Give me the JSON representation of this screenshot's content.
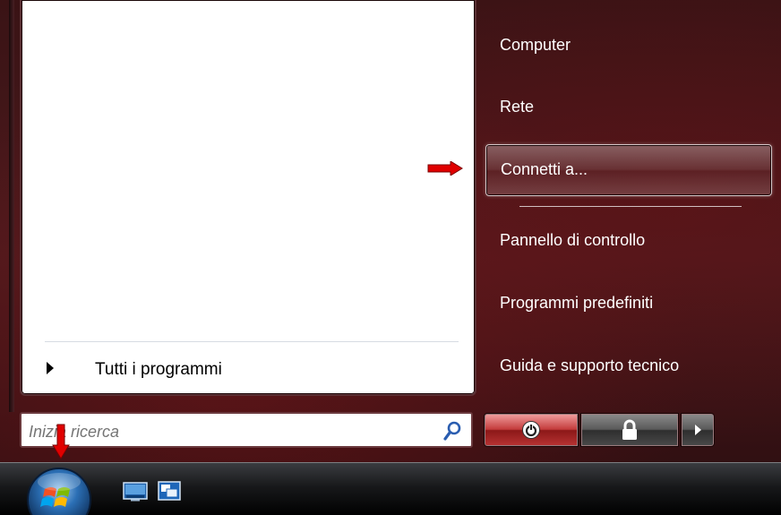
{
  "start_menu": {
    "all_programs_label": "Tutti i programmi",
    "search": {
      "placeholder": "Inizia ricerca",
      "value": ""
    },
    "right_items": [
      {
        "label": "Computer"
      },
      {
        "label": "Rete"
      },
      {
        "label": "Connetti a..."
      },
      {
        "label": "Pannello di controllo"
      },
      {
        "label": "Programmi predefiniti"
      },
      {
        "label": "Guida e supporto tecnico"
      }
    ],
    "power_buttons": [
      "power-icon",
      "lock-icon",
      "arrow-right-icon"
    ]
  },
  "annotations": {
    "arrow_color": "#e00000"
  },
  "taskbar": {
    "quicklaunch_icons": [
      "show-desktop-icon",
      "switch-windows-icon"
    ]
  }
}
